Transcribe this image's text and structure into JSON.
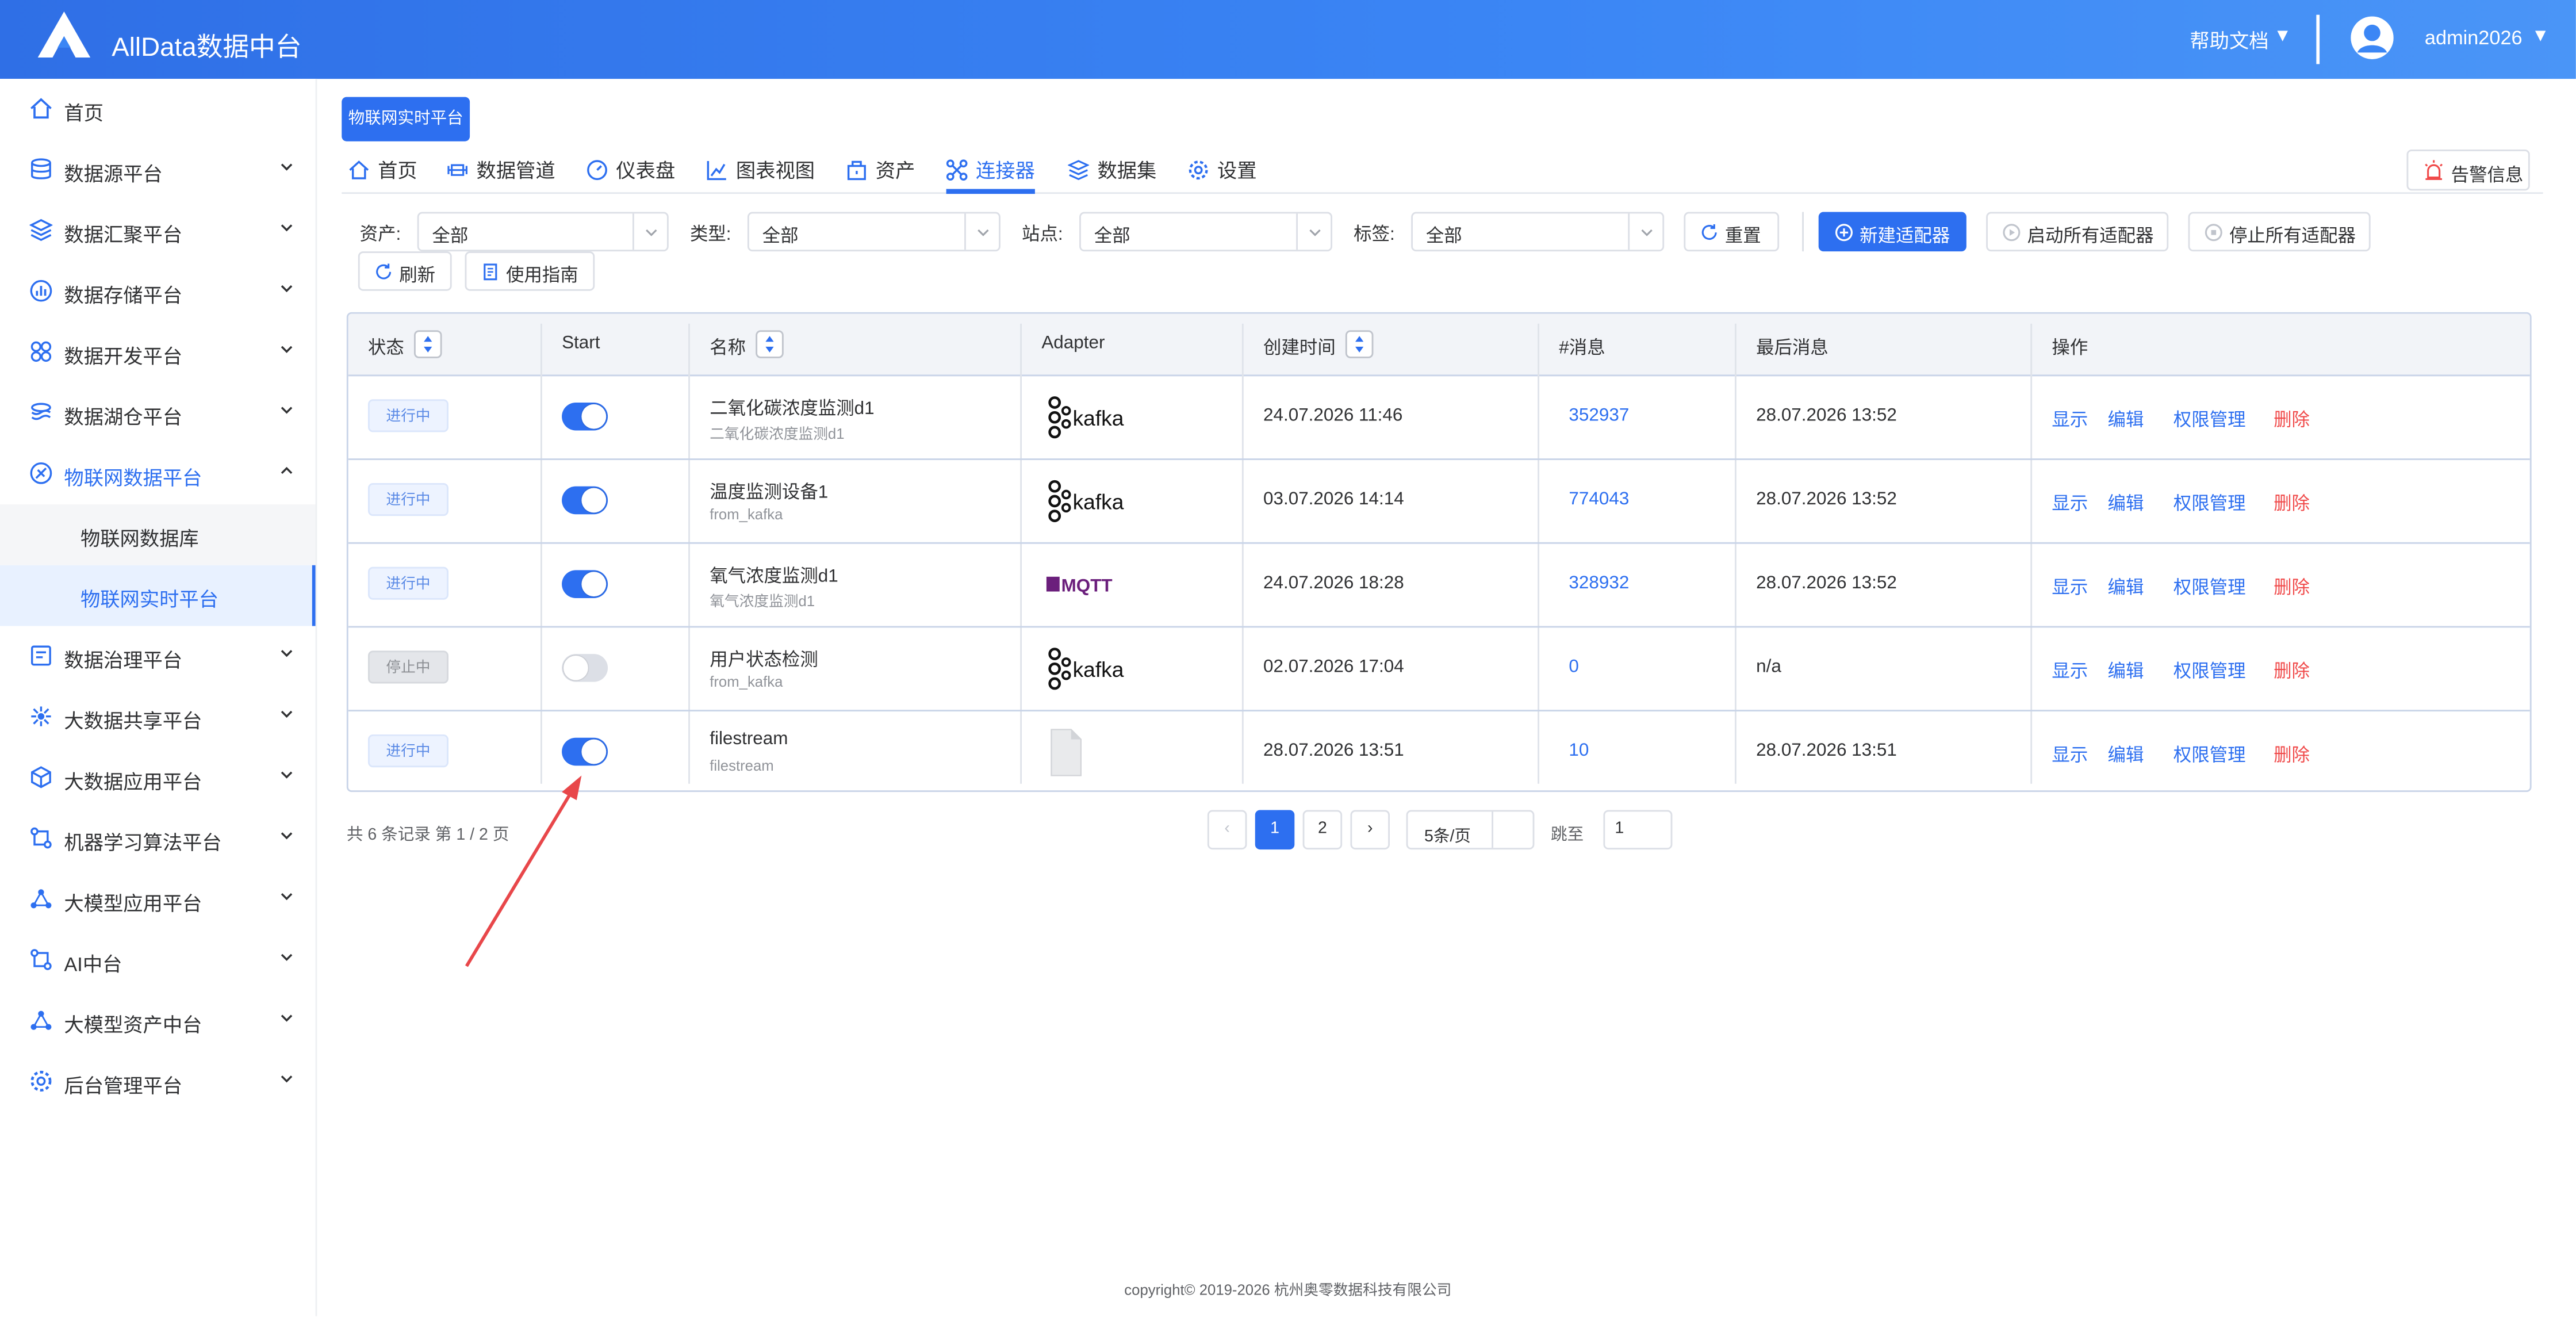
{
  "header": {
    "title": "AllData数据中台",
    "help_label": "帮助文档",
    "user_name": "admin2026",
    "caret": "▼"
  },
  "sidebar": {
    "items": [
      {
        "label": "首页",
        "icon": "home-icon"
      },
      {
        "label": "数据源平台",
        "icon": "database-icon"
      },
      {
        "label": "数据汇聚平台",
        "icon": "layers-icon"
      },
      {
        "label": "数据存储平台",
        "icon": "storage-chart-icon"
      },
      {
        "label": "数据开发平台",
        "icon": "grid-flower-icon"
      },
      {
        "label": "数据湖仓平台",
        "icon": "lake-icon"
      },
      {
        "label": "物联网数据平台",
        "icon": "iot-icon"
      },
      {
        "label": "数据治理平台",
        "icon": "governance-icon"
      },
      {
        "label": "大数据共享平台",
        "icon": "share-icon"
      },
      {
        "label": "大数据应用平台",
        "icon": "cube-icon"
      },
      {
        "label": "机器学习算法平台",
        "icon": "ml-icon"
      },
      {
        "label": "大模型应用平台",
        "icon": "model-icon"
      },
      {
        "label": "AI中台",
        "icon": "ai-icon"
      },
      {
        "label": "大模型资产中台",
        "icon": "asset-icon"
      },
      {
        "label": "后台管理平台",
        "icon": "admin-gear-icon"
      }
    ],
    "submenu": [
      {
        "label": "物联网数据库"
      },
      {
        "label": "物联网实时平台"
      }
    ]
  },
  "breadcrumb": {
    "label": "物联网实时平台"
  },
  "tabs": [
    {
      "label": "首页",
      "icon": "home-icon"
    },
    {
      "label": "数据管道",
      "icon": "pipeline-icon"
    },
    {
      "label": "仪表盘",
      "icon": "dashboard-icon"
    },
    {
      "label": "图表视图",
      "icon": "chart-icon"
    },
    {
      "label": "资产",
      "icon": "asset-icon"
    },
    {
      "label": "连接器",
      "icon": "connector-icon"
    },
    {
      "label": "数据集",
      "icon": "dataset-icon"
    },
    {
      "label": "设置",
      "icon": "settings-icon"
    }
  ],
  "alarm_label": "告警信息",
  "filters": {
    "asset": {
      "label": "资产:",
      "value": "全部"
    },
    "type": {
      "label": "类型:",
      "value": "全部"
    },
    "site": {
      "label": "站点:",
      "value": "全部"
    },
    "tag": {
      "label": "标签:",
      "value": "全部"
    }
  },
  "toolbar": {
    "reset": "重置",
    "new_adapter": "新建适配器",
    "start_all": "启动所有适配器",
    "stop_all": "停止所有适配器",
    "refresh": "刷新",
    "guide": "使用指南"
  },
  "table": {
    "headers": {
      "status": "状态",
      "start": "Start",
      "name": "名称",
      "adapter": "Adapter",
      "created": "创建时间",
      "messages": "#消息",
      "last_message": "最后消息",
      "actions": "操作"
    },
    "action_labels": {
      "show": "显示",
      "edit": "编辑",
      "perm": "权限管理",
      "delete": "删除"
    },
    "rows": [
      {
        "status": "进行中",
        "running": true,
        "name": "二氧化碳浓度监测d1",
        "sub": "二氧化碳浓度监测d1",
        "adapter": "kafka",
        "created": "24.07.2026 11:46",
        "messages": "352937",
        "last": "28.07.2026 13:52"
      },
      {
        "status": "进行中",
        "running": true,
        "name": "温度监测设备1",
        "sub": "from_kafka",
        "adapter": "kafka",
        "created": "03.07.2026 14:14",
        "messages": "774043",
        "last": "28.07.2026 13:52"
      },
      {
        "status": "进行中",
        "running": true,
        "name": "氧气浓度监测d1",
        "sub": "氧气浓度监测d1",
        "adapter": "mqtt",
        "created": "24.07.2026 18:28",
        "messages": "328932",
        "last": "28.07.2026 13:52"
      },
      {
        "status": "停止中",
        "running": false,
        "name": "用户状态检测",
        "sub": "from_kafka",
        "adapter": "kafka",
        "created": "02.07.2026 17:04",
        "messages": "0",
        "last": "n/a"
      },
      {
        "status": "进行中",
        "running": true,
        "name": "filestream",
        "sub": "filestream",
        "adapter": "file",
        "created": "28.07.2026 13:51",
        "messages": "10",
        "last": "28.07.2026 13:51"
      }
    ]
  },
  "adapter_text": {
    "kafka": "kafka",
    "mqtt": "MQTT"
  },
  "pagination": {
    "summary": "共 6 条记录 第 1 / 2 页",
    "prev": "‹",
    "pages": [
      "1",
      "2"
    ],
    "next": "›",
    "page_size": "5条/页",
    "jump_label": "跳至",
    "jump_value": "1"
  },
  "footer": "copyright© 2019-2026 杭州奥零数据科技有限公司",
  "colors": {
    "primary": "#2d6ff0",
    "danger": "#f04b4b",
    "header_gradient_start": "#2f6fe6",
    "annotation_arrow": "#e8474a"
  }
}
